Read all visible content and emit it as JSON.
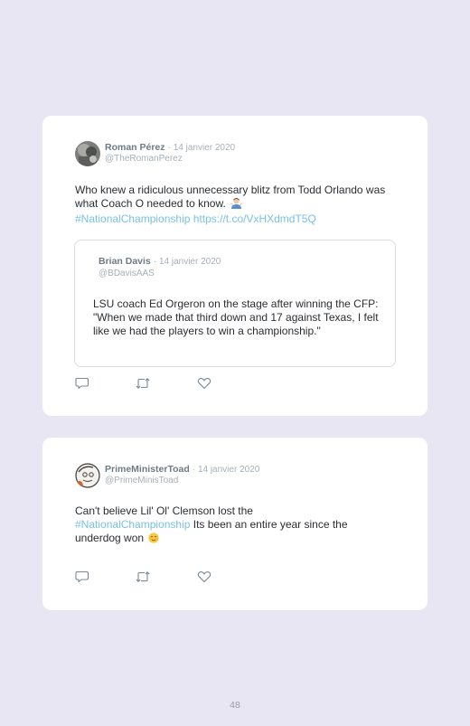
{
  "tweets": [
    {
      "author": "Roman Pérez",
      "separator": "·",
      "date": "14 janvier 2020",
      "handle": "@TheRomanPerez",
      "text": "Who knew a ridiculous unnecessary blitz from Todd Orlando was what Coach O needed to know.",
      "emoji": "man-shrugging-emoji",
      "hashtag": "#NationalChampionship",
      "link": "https://t.co/VxHXdmdT5Q",
      "quoted": {
        "author": "Brian Davis",
        "separator": "·",
        "date": "14 janvier 2020",
        "handle": "@BDavisAAS",
        "text": "LSU coach Ed Orgeron on the stage after winning the CFP: \"When we made that third down and 17 against Texas, I felt like we had the players to win a championship.\""
      },
      "actions": [
        "reply-icon",
        "retweet-icon",
        "like-icon"
      ]
    },
    {
      "author": "PrimeMinisterToad",
      "separator": "·",
      "date": "14 janvier 2020",
      "handle": "@PrimeMinisToad",
      "text_before": "Can't believe Lil' Ol' Clemson lost the",
      "hashtag": "#NationalChampionship",
      "text_after": " Its been an entire year since the underdog won",
      "emoji": "relieved-face-emoji",
      "actions": [
        "reply-icon",
        "retweet-icon",
        "like-icon"
      ]
    }
  ],
  "page_number": "48",
  "colors": {
    "background": "#e9e6f3",
    "card": "#ffffff",
    "link": "#79c1e8",
    "muted": "#a6b0b8"
  }
}
